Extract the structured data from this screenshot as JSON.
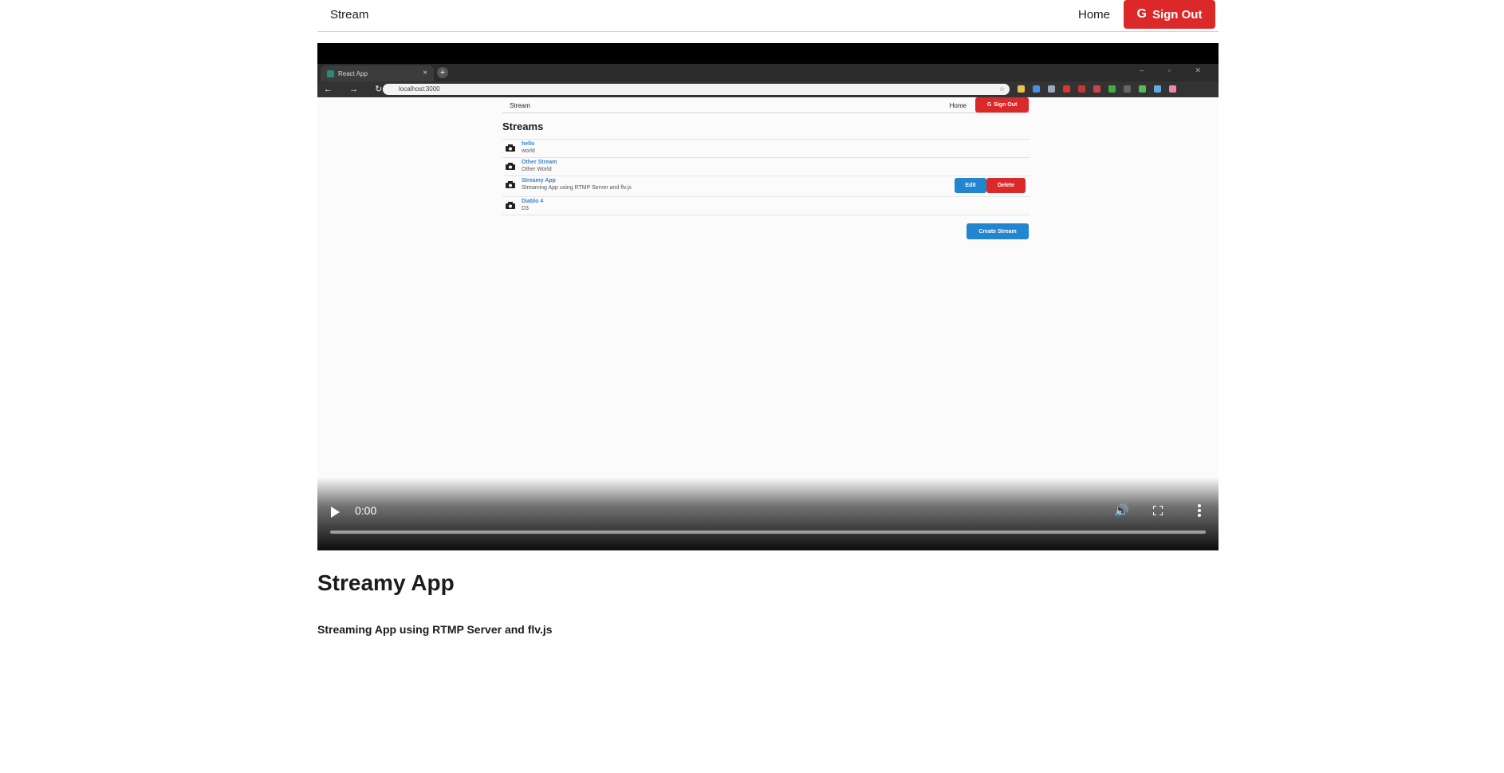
{
  "menu": {
    "brand": "Stream",
    "home": "Home",
    "sign_out": "Sign Out"
  },
  "video": {
    "browser_tab": "React App",
    "url": "localhost:3000",
    "inner_app": {
      "brand": "Stream",
      "home": "Home",
      "sign_out": "Sign Out",
      "title": "Streams",
      "streams": [
        {
          "title": "hello",
          "description": "world"
        },
        {
          "title": "Other Stream",
          "description": "Other World"
        },
        {
          "title": "Streamy App",
          "description": "Streaming App using RTMP Server and flv.js",
          "edit": "Edit",
          "delete": "Delete"
        },
        {
          "title": "Diablo 4",
          "description": "D3"
        }
      ],
      "create": "Create Stream"
    },
    "controls": {
      "time": "0:00",
      "progress": 0
    }
  },
  "stream": {
    "title": "Streamy App",
    "description": "Streaming App using RTMP Server and flv.js"
  },
  "colors": {
    "red": "#db2828",
    "blue": "#2185d0",
    "link": "#4183c4"
  }
}
